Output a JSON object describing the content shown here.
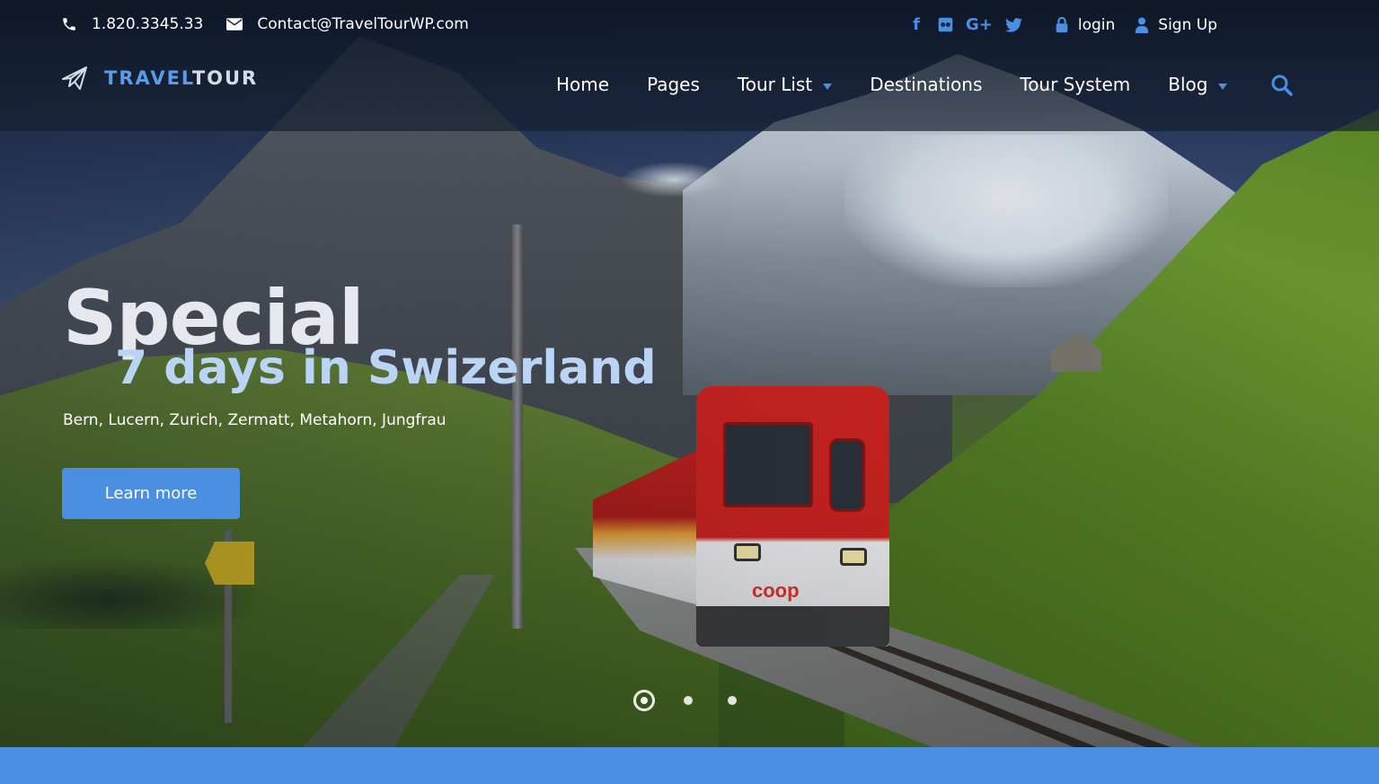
{
  "colors": {
    "accent": "#4a8fe2",
    "subtitle": "#b9d4f5",
    "bottom_bar": "#4a8fe2"
  },
  "topbar": {
    "phone": {
      "icon": "phone-icon",
      "text": "1.820.3345.33"
    },
    "email": {
      "icon": "envelope-icon",
      "text": "Contact@TravelTourWP.com"
    },
    "social": [
      {
        "icon": "facebook-icon",
        "glyph": "f"
      },
      {
        "icon": "flickr-icon",
        "glyph": "▣"
      },
      {
        "icon": "google-plus-icon",
        "glyph": "G+"
      },
      {
        "icon": "twitter-icon",
        "glyph": "❧"
      }
    ],
    "login": {
      "icon": "lock-icon",
      "label": "login"
    },
    "signup": {
      "icon": "user-icon",
      "label": "Sign Up"
    }
  },
  "logo": {
    "icon": "airplane-icon",
    "part1": "TRAVEL",
    "part2": "TOUR"
  },
  "nav": {
    "items": [
      {
        "label": "Home",
        "dropdown": false
      },
      {
        "label": "Pages",
        "dropdown": false
      },
      {
        "label": "Tour List",
        "dropdown": true
      },
      {
        "label": "Destinations",
        "dropdown": false
      },
      {
        "label": "Tour System",
        "dropdown": false
      },
      {
        "label": "Blog",
        "dropdown": true
      }
    ],
    "search_icon": "search-icon"
  },
  "hero": {
    "title": "Special",
    "subtitle": "7 days in Swizerland",
    "description": "Bern, Lucern, Zurich, Zermatt, Metahorn, Jungfrau",
    "button_label": "Learn more",
    "train_logo": "coop"
  },
  "slider": {
    "count": 3,
    "active": 1
  }
}
